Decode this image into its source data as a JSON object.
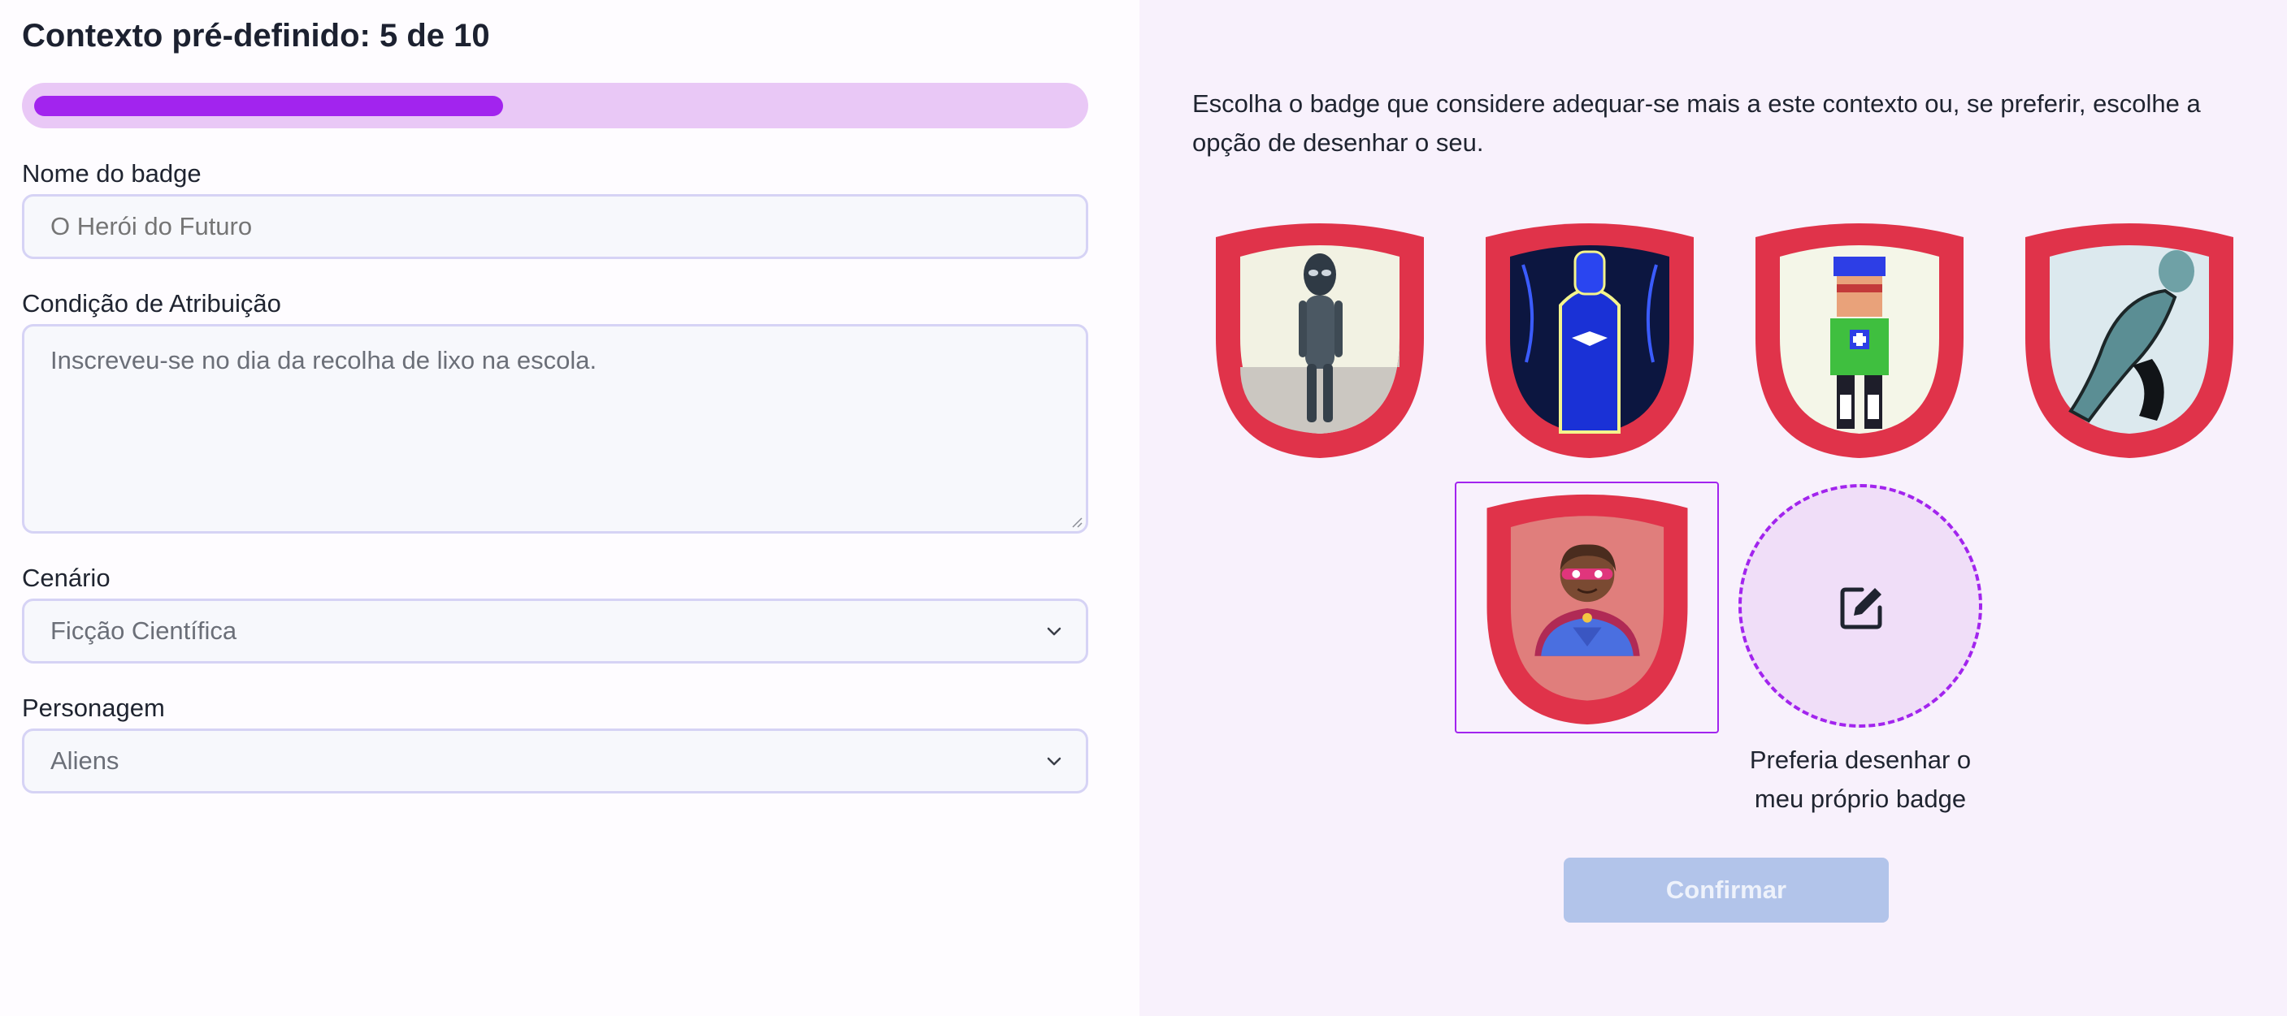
{
  "form": {
    "title": "Contexto pré-definido: 5 de 10",
    "progress": {
      "current": 5,
      "total": 10,
      "fraction": 0.45
    },
    "badge_name": {
      "label": "Nome do badge",
      "placeholder": "O Herói do Futuro"
    },
    "condition": {
      "label": "Condição de Atribuição",
      "placeholder": "Inscreveu-se no dia da recolha de lixo na escola."
    },
    "scenario": {
      "label": "Cenário",
      "value": "Ficção Científica"
    },
    "character": {
      "label": "Personagem",
      "value": "Aliens"
    }
  },
  "chooser": {
    "intro": "Escolha o badge que considere adequar-se mais a este contexto ou, se preferir, escolhe a opção de desenhar o seu.",
    "badges": [
      {
        "name": "grey-alien-badge",
        "selected": false
      },
      {
        "name": "blue-glowing-figure-badge",
        "selected": false
      },
      {
        "name": "pixel-hero-badge",
        "selected": false
      },
      {
        "name": "leaping-alien-badge",
        "selected": false
      },
      {
        "name": "superhero-emoji-badge",
        "selected": true
      }
    ],
    "draw_option": "Preferia desenhar o meu próprio badge",
    "confirm_label": "Confirmar"
  },
  "colors": {
    "accent": "#a224ee",
    "progress_track": "#e9c8f6",
    "badge_frame": "#e0334a",
    "confirm_disabled": "#b2c4ea",
    "right_panel_bg": "#f8f1fc"
  },
  "icons": {
    "select_chevron": "chevron-down-icon",
    "draw": "edit-icon"
  }
}
